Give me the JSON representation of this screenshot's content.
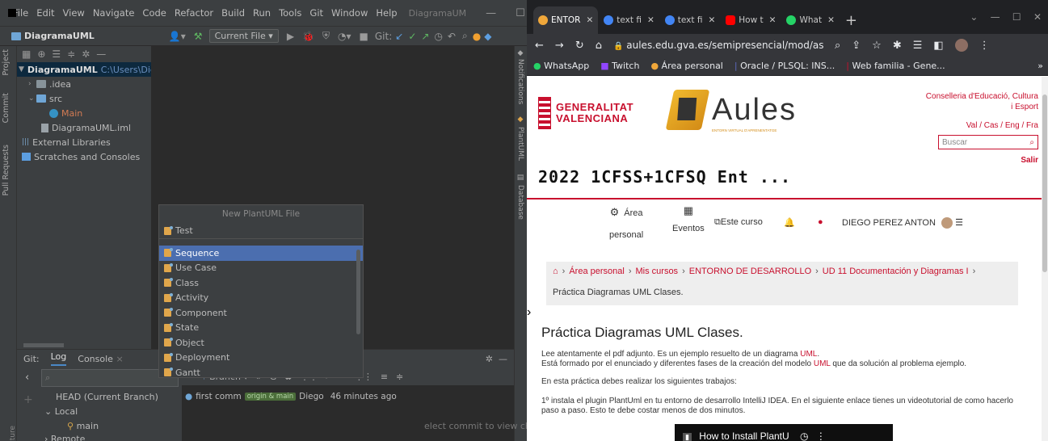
{
  "ide": {
    "menu": [
      "File",
      "Edit",
      "View",
      "Navigate",
      "Code",
      "Refactor",
      "Build",
      "Run",
      "Tools",
      "Git",
      "Window",
      "Help"
    ],
    "title": "DiagramaUM",
    "project_crumb": "DiagramaUML",
    "run_config": "Current File",
    "git_label": "Git:",
    "left_tabs": [
      "Project",
      "Commit",
      "Pull Requests"
    ],
    "right_tabs": [
      "Notifications",
      "PlantUML",
      "Database"
    ],
    "tree": [
      {
        "label": "DiagramaUML",
        "path": "C:\\Users\\Diere",
        "depth": 0
      },
      {
        "label": ".idea",
        "depth": 1
      },
      {
        "label": "src",
        "depth": 1
      },
      {
        "label": "Main",
        "depth": 2
      },
      {
        "label": "DiagramaUML.iml",
        "depth": 1
      },
      {
        "label": "External Libraries",
        "depth": 0
      },
      {
        "label": "Scratches and Consoles",
        "depth": 0
      }
    ],
    "popup": {
      "title": "New PlantUML File",
      "input": "Test",
      "items": [
        "Sequence",
        "Use Case",
        "Class",
        "Activity",
        "Component",
        "State",
        "Object",
        "Deployment",
        "Gantt"
      ],
      "selected": "Sequence"
    },
    "bottom": {
      "git_label": "Git:",
      "tabs": [
        "Log",
        "Console"
      ],
      "branch_label": "Branch",
      "head": "HEAD (Current Branch)",
      "local": "Local",
      "main_branch": "main",
      "remote": "Remote",
      "commit": {
        "message": "first comm",
        "tag": "origin & main",
        "author": "Diego",
        "time": "46 minutes ago"
      },
      "hint": "elect commit to view chang",
      "side_label": "cture"
    }
  },
  "browser": {
    "tabs": [
      {
        "title": "ENTOR",
        "color": "#f0a73a",
        "active": true
      },
      {
        "title": "text fi",
        "color": "#4285f4",
        "active": false
      },
      {
        "title": "text fi",
        "color": "#4285f4",
        "active": false
      },
      {
        "title": "How t",
        "color": "#ff0000",
        "active": false
      },
      {
        "title": "What",
        "color": "#25d366",
        "active": false
      }
    ],
    "url": "aules.edu.gva.es/semipresencial/mod/assign/view...",
    "bookmarks": [
      "WhatsApp",
      "Twitch",
      "Área personal",
      "Oracle / PLSQL: INS...",
      "Web familia - Gene..."
    ],
    "page": {
      "gv_line1": "GENERALITAT",
      "gv_line2": "VALENCIANA",
      "aules": "Aules",
      "aules_sub": "ENTORN VIRTUAL D'APRENENTATGE",
      "conselleria": "Conselleria d'Educació, Cultura i Esport",
      "lang": "Val / Cas / Eng / Fra",
      "search_placeholder": "Buscar",
      "salir": "Salir",
      "course": "2022 1CFSS+1CFSQ Ent ...",
      "nav": {
        "area1": "Área",
        "area2": "personal",
        "eventos": "Eventos",
        "este_curso": "Este curso",
        "user": "DIEGO PEREZ ANTON"
      },
      "crumbs": [
        "Área personal",
        "Mis cursos",
        "ENTORNO DE DESARROLLO",
        "UD 11 Documentación y Diagramas I"
      ],
      "crumb_current": "Práctica Diagramas UML Clases.",
      "heading": "Práctica Diagramas UML Clases.",
      "p1a": "Lee atentamente el pdf adjunto. Es un ejemplo resuelto de un diagrama ",
      "p1link": "UML",
      "p1b": ".",
      "p2a": "Está formado por el enunciado y diferentes fases de la creación del modelo ",
      "p2link": "UML",
      "p2b": " que da solución al problema ejemplo.",
      "p3": "En esta práctica debes realizar los siguientes trabajos:",
      "p4": "1º instala el plugin PlantUml en tu entorno de desarrollo IntelliJ IDEA. En el siguiente enlace tienes un videotutorial de como hacerlo paso a paso. Esto te debe costar menos de dos minutos.",
      "video_title": "How to Install PlantU"
    }
  }
}
